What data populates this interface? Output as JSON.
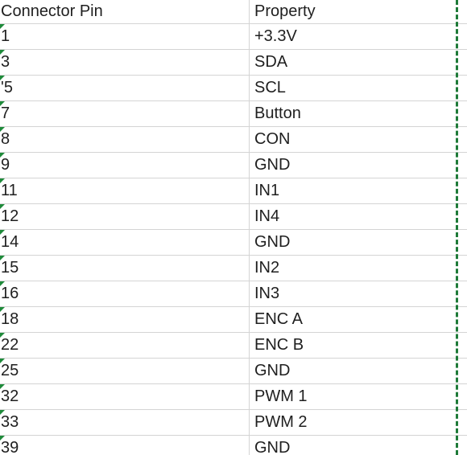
{
  "headers": {
    "col_a": "Connector Pin",
    "col_b": "Property"
  },
  "rows": [
    {
      "pin": "1",
      "property": "+3.3V"
    },
    {
      "pin": "3",
      "property": "SDA"
    },
    {
      "pin": "'5",
      "property": "SCL"
    },
    {
      "pin": "7",
      "property": "Button"
    },
    {
      "pin": "8",
      "property": "CON"
    },
    {
      "pin": "9",
      "property": "GND"
    },
    {
      "pin": "11",
      "property": "IN1"
    },
    {
      "pin": "12",
      "property": "IN4"
    },
    {
      "pin": "14",
      "property": "GND"
    },
    {
      "pin": "15",
      "property": "IN2"
    },
    {
      "pin": "16",
      "property": "IN3"
    },
    {
      "pin": "18",
      "property": "ENC A"
    },
    {
      "pin": "22",
      "property": "ENC B"
    },
    {
      "pin": "25",
      "property": "GND"
    },
    {
      "pin": "32",
      "property": "PWM 1"
    },
    {
      "pin": "33",
      "property": "PWM 2"
    },
    {
      "pin": "39",
      "property": "GND"
    }
  ],
  "colors": {
    "gridline": "#d4d4d4",
    "error_indicator": "#1e8a3a",
    "page_break_line": "#1e7a38"
  }
}
